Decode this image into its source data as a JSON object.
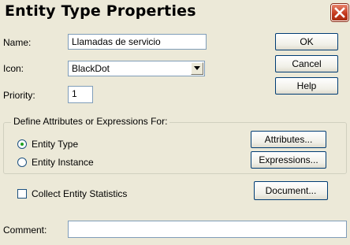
{
  "dialog": {
    "title": "Entity Type Properties",
    "close_icon": "close-icon"
  },
  "fields": {
    "name_label": "Name:",
    "name_value": "Llamadas de servicio",
    "icon_label": "Icon:",
    "icon_value": "BlackDot",
    "priority_label": "Priority:",
    "priority_value": "1",
    "comment_label": "Comment:",
    "comment_value": ""
  },
  "buttons": {
    "ok": "OK",
    "cancel": "Cancel",
    "help": "Help",
    "attributes": "Attributes...",
    "expressions": "Expressions...",
    "document": "Document..."
  },
  "group": {
    "label": "Define Attributes or Expressions For:",
    "options": [
      {
        "label": "Entity Type",
        "selected": true
      },
      {
        "label": "Entity Instance",
        "selected": false
      }
    ]
  },
  "options": {
    "collect_stats_label": "Collect Entity Statistics",
    "collect_stats_checked": false
  },
  "colors": {
    "window_bg": "#ece9d8",
    "close_red": "#c2371a",
    "field_border": "#7f9db9",
    "button_border": "#003c74",
    "radio_dot": "#21a121"
  }
}
